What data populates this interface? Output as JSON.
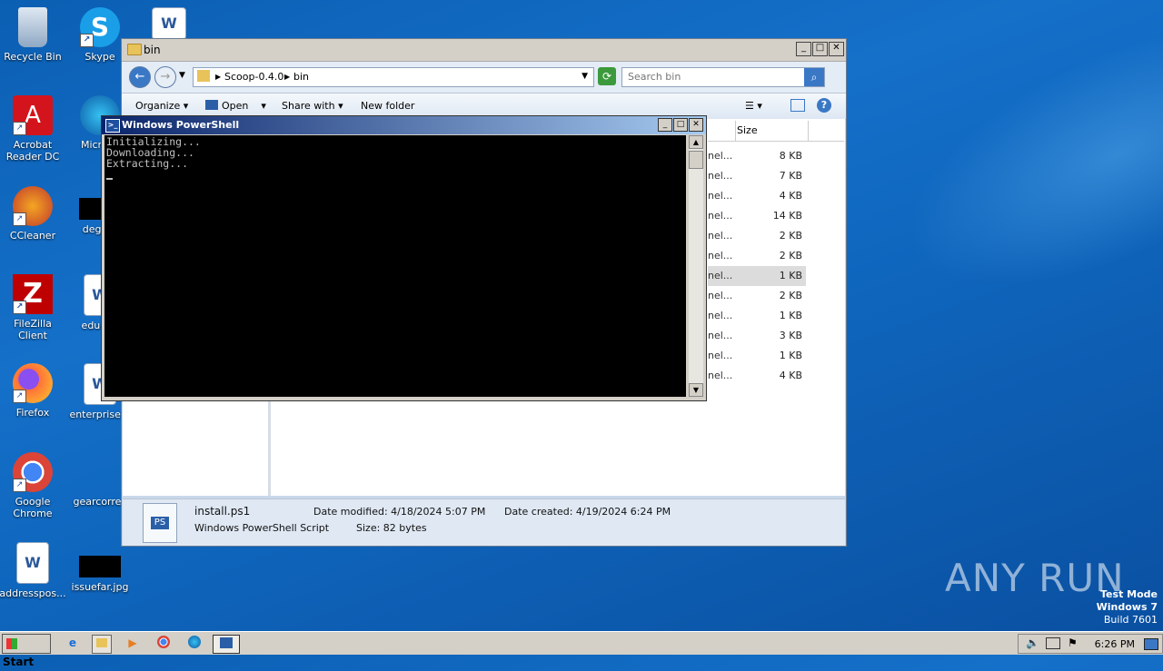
{
  "desktop": {
    "icons": [
      {
        "label": "Recycle Bin"
      },
      {
        "label": "Skype"
      },
      {
        "label": "Acrobat Reader DC"
      },
      {
        "label": "Microso"
      },
      {
        "label": "CCleaner"
      },
      {
        "label": "degree"
      },
      {
        "label": "FileZilla Client"
      },
      {
        "label": "educati"
      },
      {
        "label": "Firefox"
      },
      {
        "label": "enterprisem"
      },
      {
        "label": "Google Chrome"
      },
      {
        "label": "gearcorrec"
      },
      {
        "label": "addresspos..."
      },
      {
        "label": "issuefar.jpg"
      }
    ]
  },
  "explorer": {
    "title": "bin",
    "breadcrumb": [
      "Scoop-0.4.0",
      "bin"
    ],
    "search_placeholder": "Search bin",
    "toolbar": {
      "organize": "Organize",
      "open": "Open",
      "share_with": "Share with",
      "new_folder": "New folder"
    },
    "column_size": "Size",
    "rows": [
      {
        "type": "nel...",
        "size": "8 KB"
      },
      {
        "type": "nel...",
        "size": "7 KB"
      },
      {
        "type": "nel...",
        "size": "4 KB"
      },
      {
        "type": "nel...",
        "size": "14 KB"
      },
      {
        "type": "nel...",
        "size": "2 KB"
      },
      {
        "type": "nel...",
        "size": "2 KB"
      },
      {
        "type": "nel...",
        "size": "1 KB"
      },
      {
        "type": "nel...",
        "size": "2 KB"
      },
      {
        "type": "nel...",
        "size": "1 KB"
      },
      {
        "type": "nel...",
        "size": "3 KB"
      },
      {
        "type": "nel...",
        "size": "1 KB"
      },
      {
        "type": "nel...",
        "size": "4 KB"
      }
    ],
    "details": {
      "filename": "install.ps1",
      "filetype": "Windows PowerShell Script",
      "date_modified": "Date modified: 4/18/2024 5:07 PM",
      "size": "Size: 82 bytes",
      "date_created": "Date created: 4/19/2024 6:24 PM"
    }
  },
  "powershell": {
    "title": "Windows PowerShell",
    "lines": [
      "Initializing...",
      "Downloading...",
      "Extracting..."
    ]
  },
  "taskbar": {
    "start_label": "Start",
    "clock": "6:26 PM"
  },
  "watermark": "ANY RUN",
  "testmode": {
    "line1": "Test Mode",
    "line2": "Windows 7",
    "line3": "Build 7601"
  }
}
